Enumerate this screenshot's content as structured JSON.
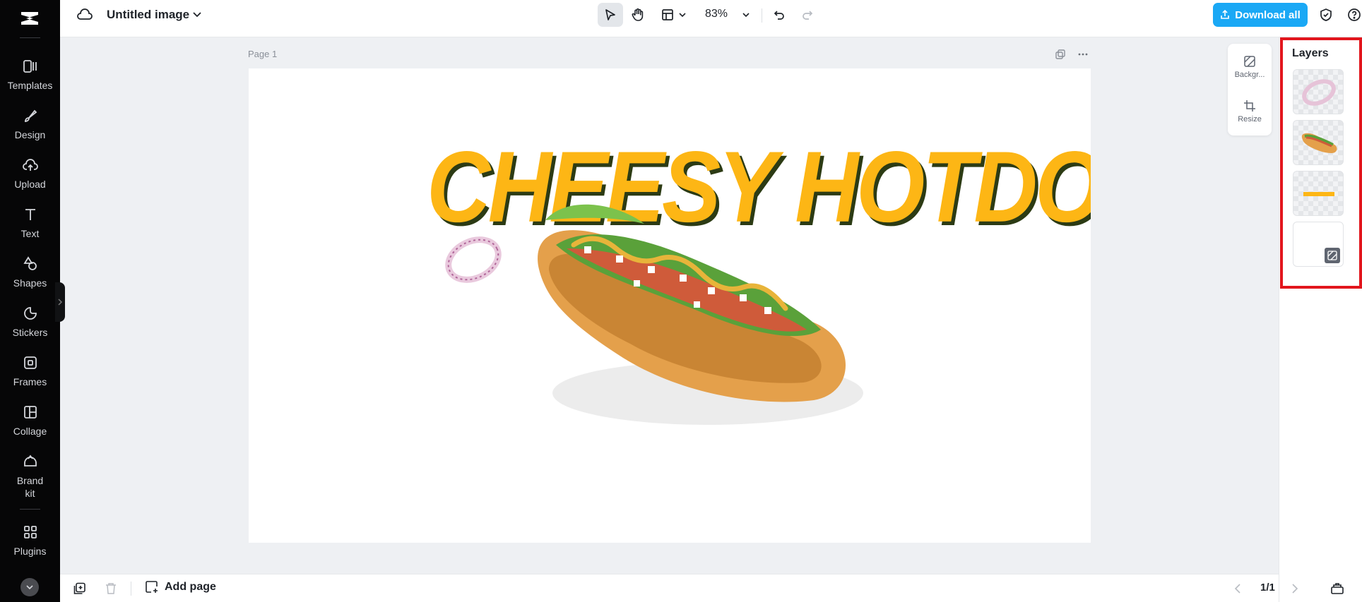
{
  "sidebar": {
    "items": [
      {
        "label": "Templates",
        "icon": "templates-icon"
      },
      {
        "label": "Design",
        "icon": "design-icon"
      },
      {
        "label": "Upload",
        "icon": "upload-icon"
      },
      {
        "label": "Text",
        "icon": "text-icon"
      },
      {
        "label": "Shapes",
        "icon": "shapes-icon"
      },
      {
        "label": "Stickers",
        "icon": "stickers-icon"
      },
      {
        "label": "Frames",
        "icon": "frames-icon"
      },
      {
        "label": "Collage",
        "icon": "collage-icon"
      },
      {
        "label": "Brand kit",
        "icon": "brand-kit-icon"
      },
      {
        "label": "Plugins",
        "icon": "plugins-icon"
      }
    ]
  },
  "topbar": {
    "title": "Untitled image",
    "zoom": "83%",
    "download_label": "Download all"
  },
  "canvas": {
    "page_label": "Page 1",
    "headline": "CHEESY HOTDOG"
  },
  "float_tools": {
    "background_label": "Backgr...",
    "resize_label": "Resize"
  },
  "layers": {
    "title": "Layers"
  },
  "bottombar": {
    "add_page_label": "Add page",
    "page_indicator": "1/1"
  },
  "colors": {
    "accent": "#1aa8f5",
    "headline": "#fdb615",
    "headline_shadow": "#2c3b14",
    "highlight_frame": "#e2161d"
  }
}
